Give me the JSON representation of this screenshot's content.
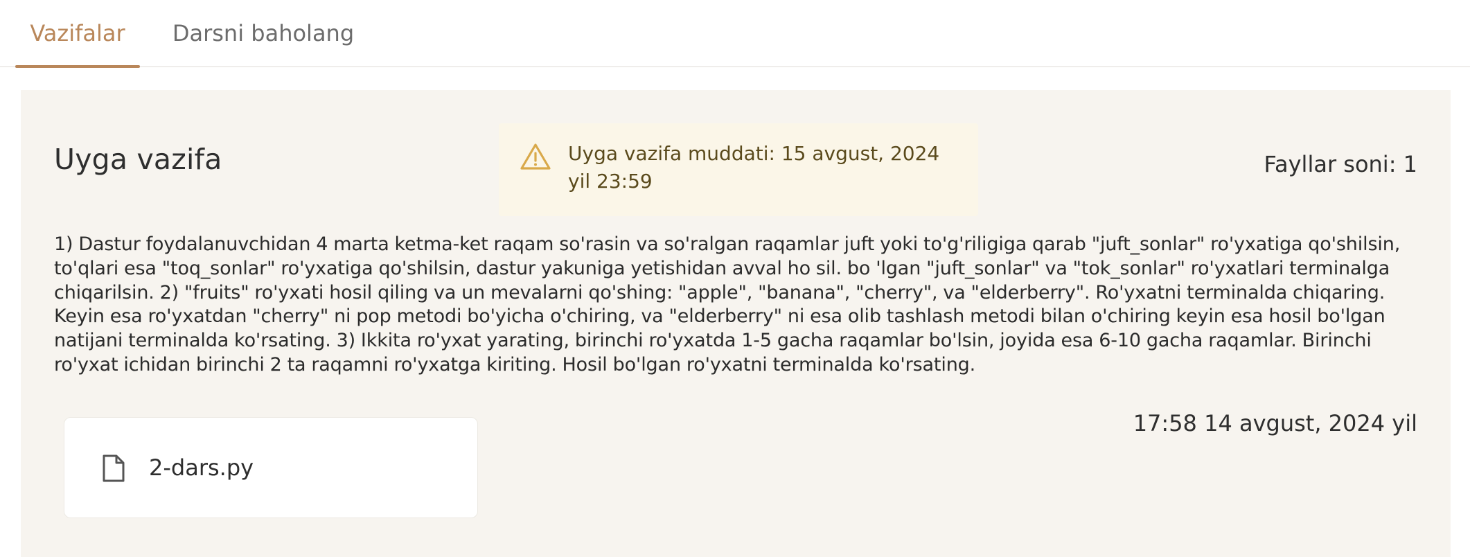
{
  "tabs": [
    {
      "label": "Vazifalar",
      "active": true
    },
    {
      "label": "Darsni baholang",
      "active": false
    }
  ],
  "panel": {
    "title": "Uyga vazifa",
    "deadline": {
      "icon": "warning-triangle-icon",
      "line1": "Uyga vazifa muddati: 15 avgust, 2024",
      "line2": "yil 23:59"
    },
    "file_count": "Fayllar soni: 1",
    "description": "1) Dastur foydalanuvchidan 4 marta ketma-ket raqam so'rasin va so'ralgan raqamlar juft yoki to'g'riligiga qarab \"juft_sonlar\" ro'yxatiga qo'shilsin, to'qlari esa \"toq_sonlar\" ro'yxatiga qo'shilsin, dastur yakuniga yetishidan avval ho sil. bo 'lgan \"juft_sonlar\" va \"tok_sonlar\" ro'yxatlari terminalga chiqarilsin. 2) \"fruits\" ro'yxati hosil qiling va un mevalarni qo'shing: \"apple\", \"banana\", \"cherry\", va \"elderberry\". Ro'yxatni terminalda chiqaring. Keyin esa ro'yxatdan \"cherry\" ni pop metodi bo'yicha o'chiring, va \"elderberry\" ni esa olib tashlash metodi bilan o'chiring keyin esa hosil bo'lgan natijani terminalda ko'rsating. 3) Ikkita ro'yxat yarating, birinchi ro'yxatda 1-5 gacha raqamlar bo'lsin, joyida esa 6-10 gacha raqamlar. Birinchi ro'yxat ichidan birinchi 2 ta raqamni ro'yxatga kiriting. Hosil bo'lgan ro'yxatni terminalda ko'rsating.",
    "file": {
      "icon": "file-icon",
      "name": "2-dars.py"
    },
    "timestamp": "17:58 14 avgust, 2024 yil"
  },
  "colors": {
    "accent": "#b9875a",
    "panel_bg": "#f7f4ef",
    "deadline_bg": "#fbf6e8",
    "warning": "#d9a94a"
  }
}
